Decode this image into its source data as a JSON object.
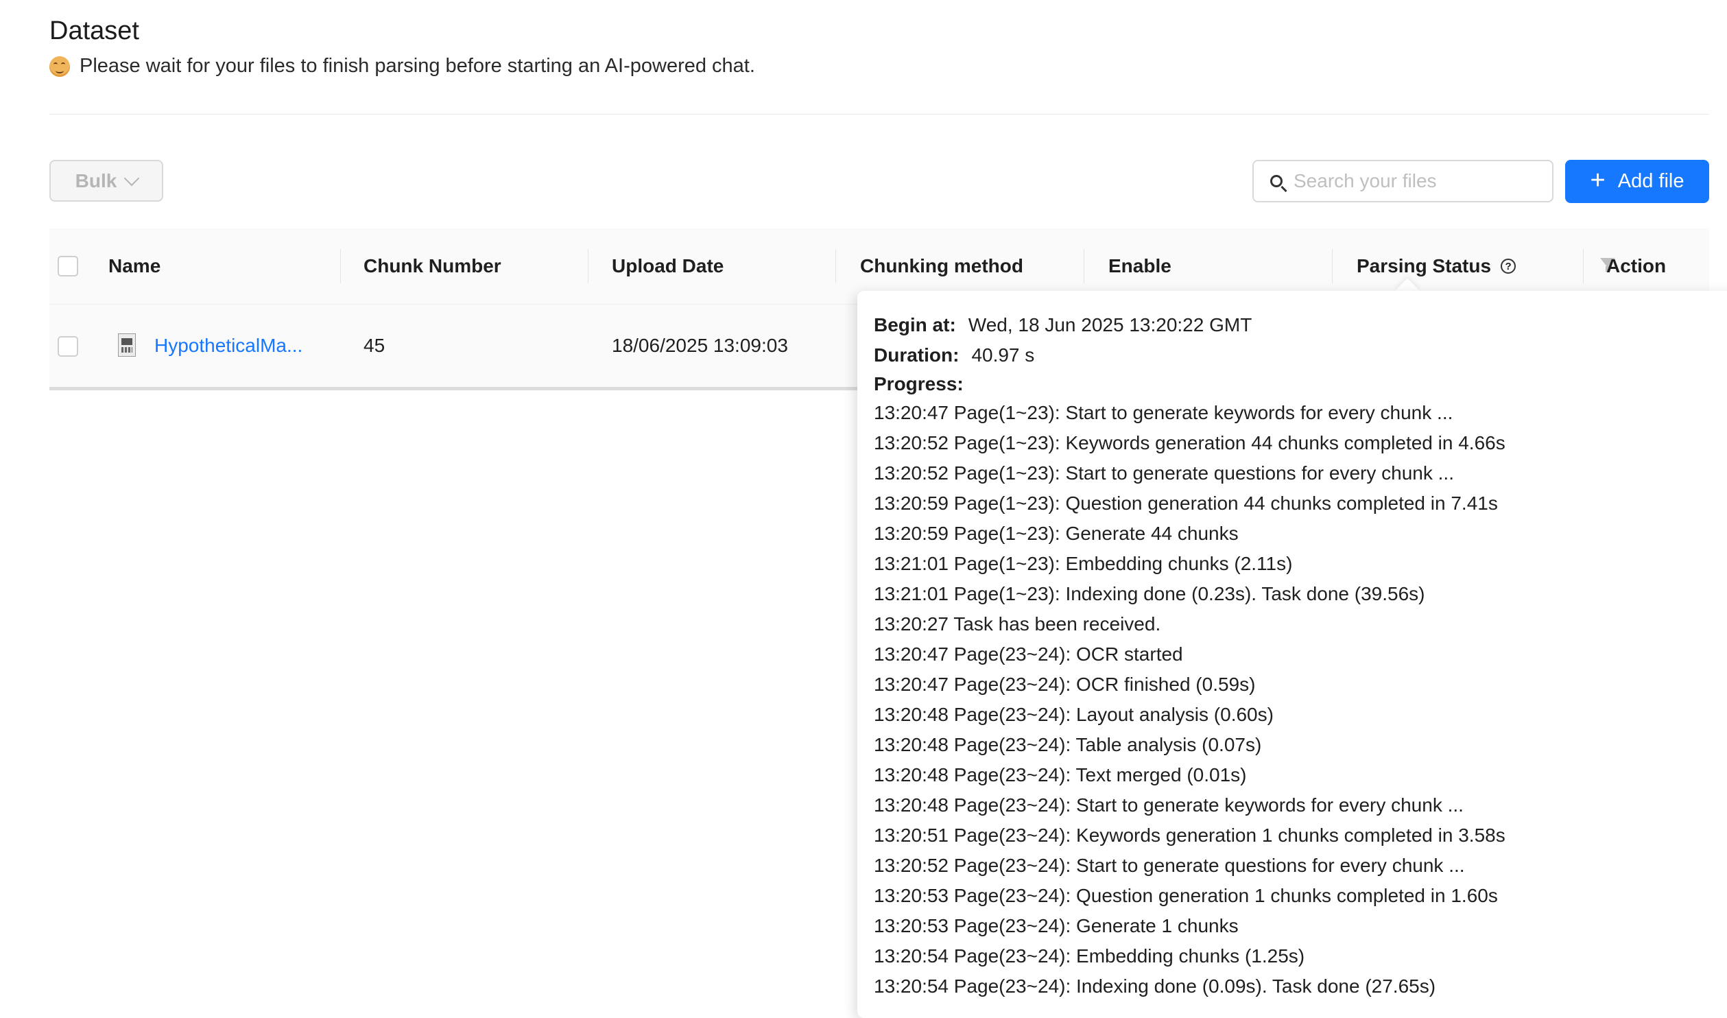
{
  "header": {
    "title": "Dataset",
    "subtitle": "Please wait for your files to finish parsing before starting an AI-powered chat.",
    "subtitle_icon": "smiling-face-emoji"
  },
  "toolbar": {
    "bulk_label": "Bulk",
    "search_placeholder": "Search your files",
    "search_value": "",
    "add_file_label": "Add file",
    "accent_color": "#1677ff"
  },
  "table": {
    "columns": [
      "Name",
      "Chunk Number",
      "Upload Date",
      "Chunking method",
      "Enable",
      "Parsing Status",
      "Action"
    ],
    "rows": [
      {
        "name": "HypotheticalMa...",
        "chunk_number": "45",
        "upload_date": "18/06/2025 13:09:03"
      }
    ]
  },
  "popover": {
    "begin_label": "Begin at:",
    "begin_value": "Wed, 18 Jun 2025 13:20:22 GMT",
    "duration_label": "Duration:",
    "duration_value": "40.97 s",
    "progress_label": "Progress:",
    "log": [
      "13:20:47 Page(1~23): Start to generate keywords for every chunk ...",
      "13:20:52 Page(1~23): Keywords generation 44 chunks completed in 4.66s",
      "13:20:52 Page(1~23): Start to generate questions for every chunk ...",
      "13:20:59 Page(1~23): Question generation 44 chunks completed in 7.41s",
      "13:20:59 Page(1~23): Generate 44 chunks",
      "13:21:01 Page(1~23): Embedding chunks (2.11s)",
      "13:21:01 Page(1~23): Indexing done (0.23s). Task done (39.56s)",
      "13:20:27 Task has been received.",
      "13:20:47 Page(23~24): OCR started",
      "13:20:47 Page(23~24): OCR finished (0.59s)",
      "13:20:48 Page(23~24): Layout analysis (0.60s)",
      "13:20:48 Page(23~24): Table analysis (0.07s)",
      "13:20:48 Page(23~24): Text merged (0.01s)",
      "13:20:48 Page(23~24): Start to generate keywords for every chunk ...",
      "13:20:51 Page(23~24): Keywords generation 1 chunks completed in 3.58s",
      "13:20:52 Page(23~24): Start to generate questions for every chunk ...",
      "13:20:53 Page(23~24): Question generation 1 chunks completed in 1.60s",
      "13:20:53 Page(23~24): Generate 1 chunks",
      "13:20:54 Page(23~24): Embedding chunks (1.25s)",
      "13:20:54 Page(23~24): Indexing done (0.09s). Task done (27.65s)"
    ]
  }
}
